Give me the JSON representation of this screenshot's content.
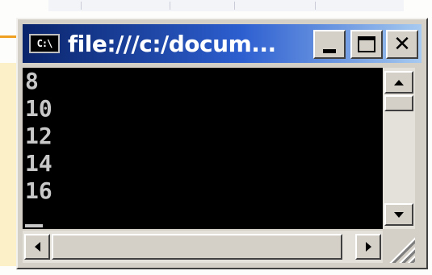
{
  "window": {
    "title": "file:///c:/docum...",
    "icon_text": "C:\\"
  },
  "console": {
    "lines": [
      "8",
      "10",
      "12",
      "14",
      "16"
    ]
  },
  "icons": {
    "app": "console-app-icon",
    "minimize": "minimize-icon",
    "maximize": "maximize-icon",
    "close": "close-icon",
    "scroll_up": "arrow-up-icon",
    "scroll_down": "arrow-down-icon",
    "scroll_left": "arrow-left-icon",
    "scroll_right": "arrow-right-icon",
    "resize": "size-grip-icon"
  },
  "colors": {
    "titlebar_start": "#0a246a",
    "titlebar_end": "#a6caf0",
    "console_bg": "#000000",
    "console_text": "#c8c8c8",
    "chrome": "#d4d0c8"
  }
}
